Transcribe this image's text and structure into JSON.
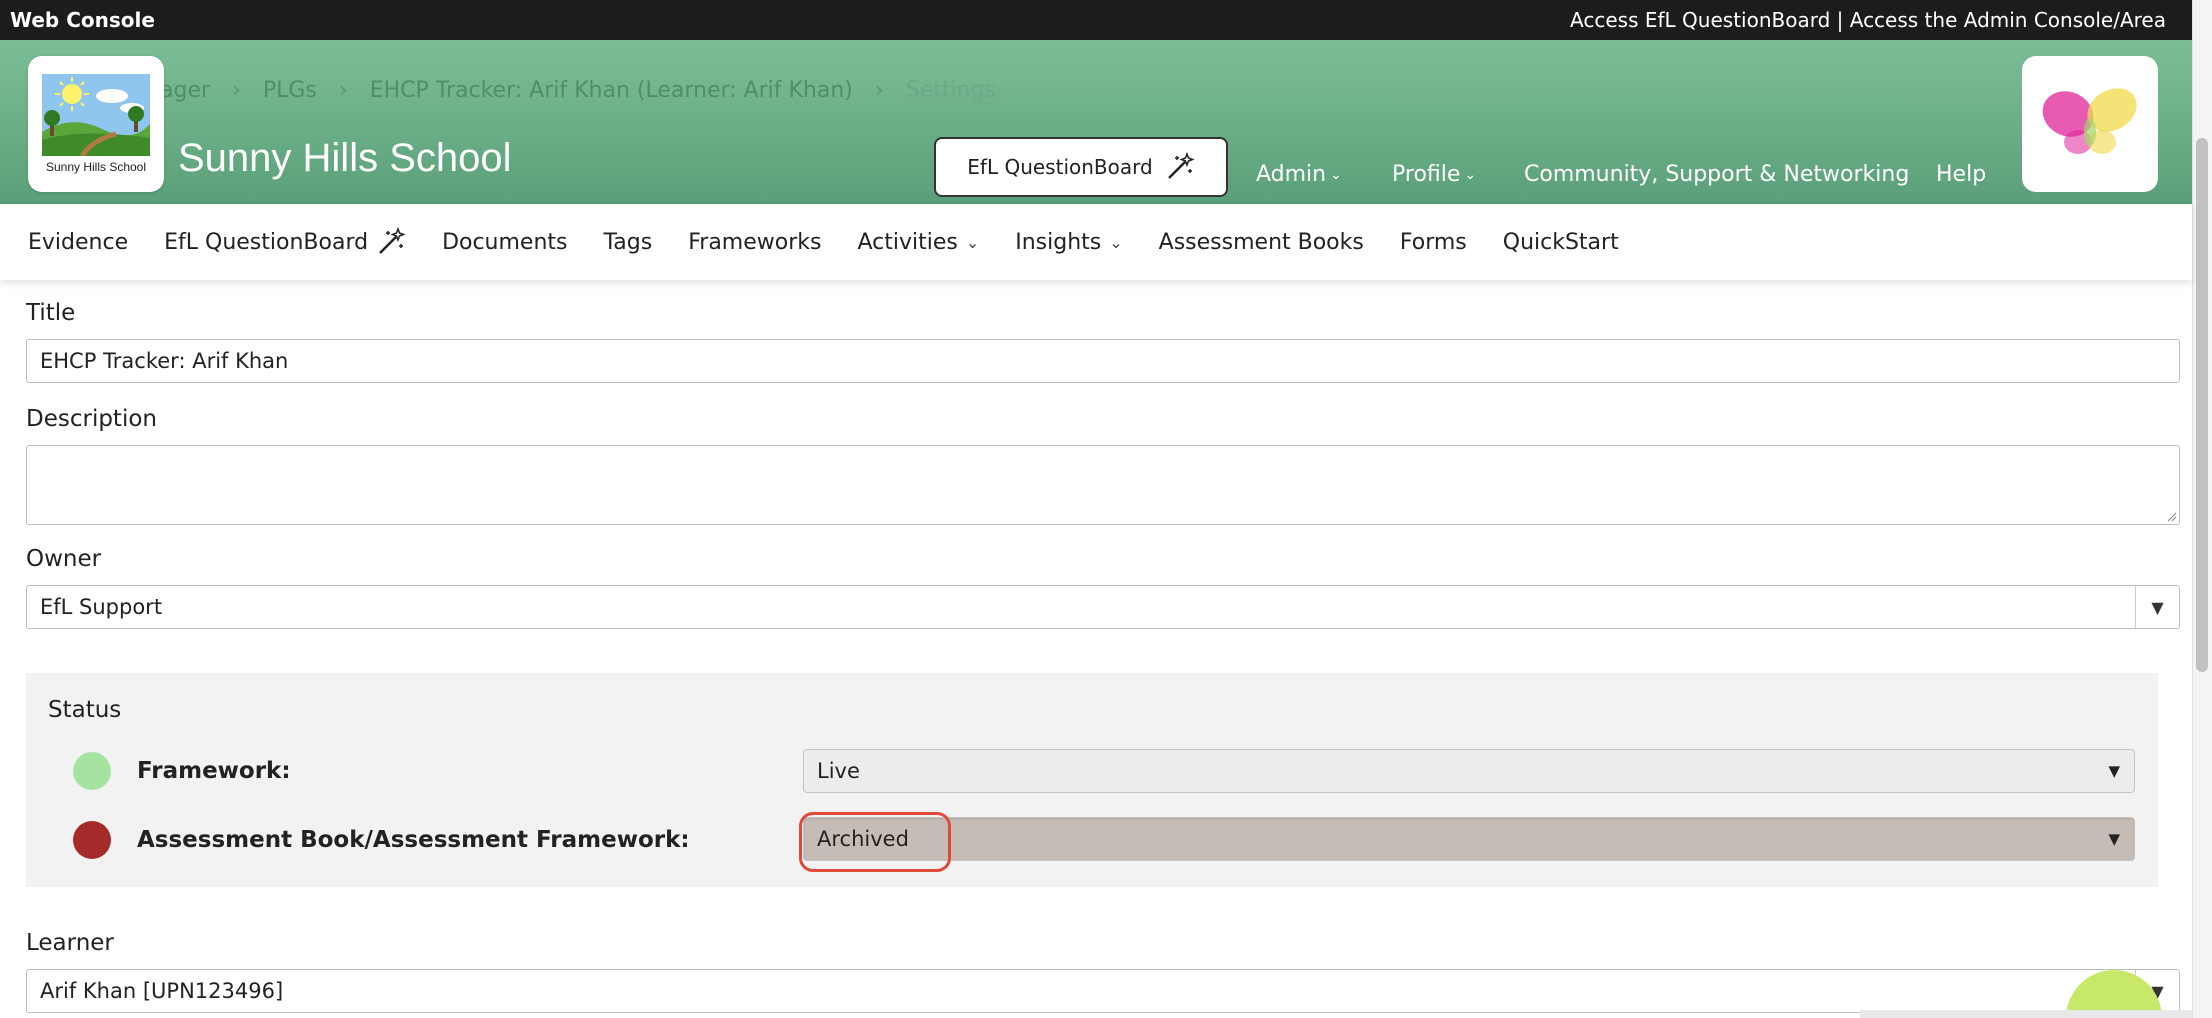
{
  "topbar": {
    "left": "Web Console",
    "right": "Access EfL QuestionBoard | Access the Admin Console/Area"
  },
  "breadcrumb": [
    "ager",
    "PLGs",
    "EHCP Tracker: Arif Khan (Learner: Arif Khan)",
    "Settings"
  ],
  "school": {
    "logo_caption": "Sunny Hills School",
    "name": "Sunny Hills School"
  },
  "header": {
    "qb_button": "EfL QuestionBoard",
    "nav": [
      {
        "label": "Admin",
        "dropdown": true
      },
      {
        "label": "Profile",
        "dropdown": true
      },
      {
        "label": "Community, Support & Networking",
        "dropdown": false
      },
      {
        "label": "Help",
        "dropdown": false
      }
    ]
  },
  "subnav": [
    {
      "label": "Evidence"
    },
    {
      "label": "EfL QuestionBoard",
      "icon": "magic-wand-icon"
    },
    {
      "label": "Documents"
    },
    {
      "label": "Tags"
    },
    {
      "label": "Frameworks"
    },
    {
      "label": "Activities",
      "dropdown": true
    },
    {
      "label": "Insights",
      "dropdown": true
    },
    {
      "label": "Assessment Books"
    },
    {
      "label": "Forms"
    },
    {
      "label": "QuickStart"
    }
  ],
  "form": {
    "title_label": "Title",
    "title_value": "EHCP Tracker: Arif Khan",
    "description_label": "Description",
    "description_value": "",
    "owner_label": "Owner",
    "owner_value": "EfL Support",
    "status": {
      "title": "Status",
      "rows": [
        {
          "label": "Framework:",
          "value": "Live",
          "dot_color": "#a6e3a1"
        },
        {
          "label": "Assessment Book/Assessment Framework:",
          "value": "Archived",
          "dot_color": "#a52a2a"
        }
      ]
    },
    "learner_label": "Learner",
    "learner_value": "Arif Khan [UPN123496]"
  },
  "colors": {
    "header_green": "#6aae87",
    "highlight_red": "#e04a3a",
    "archived_bg": "#c4bcb5",
    "live_bg": "#ececec"
  }
}
